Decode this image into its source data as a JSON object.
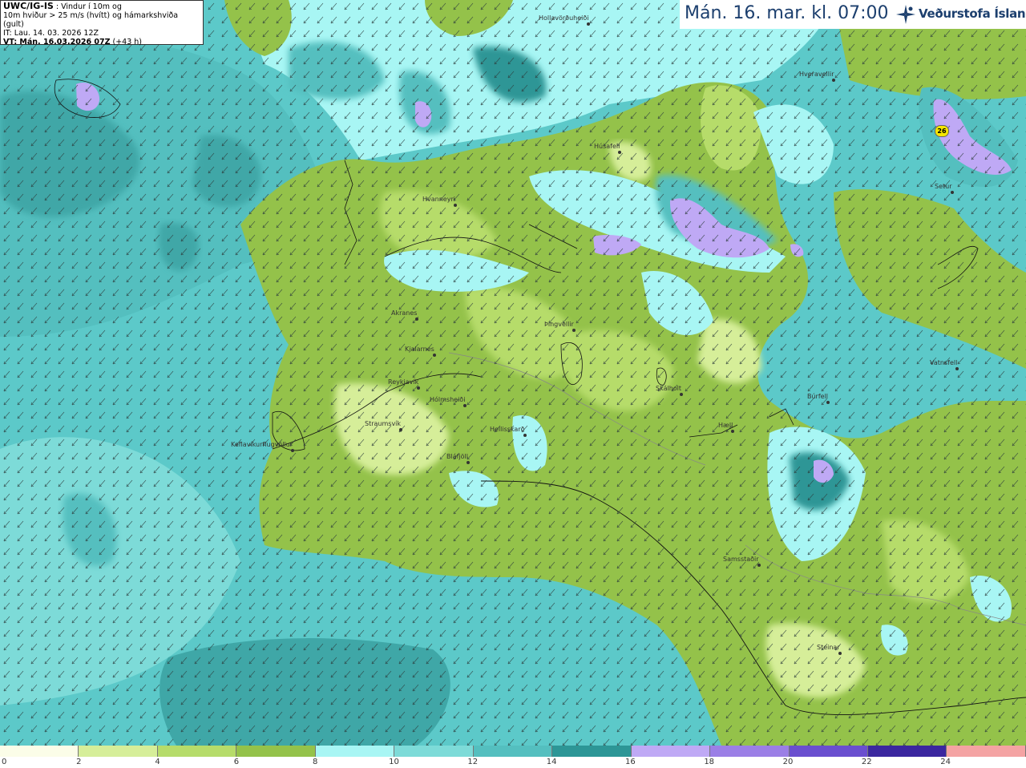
{
  "info": {
    "model": "UWC/IG-IS",
    "line1_suffix": " : Vindur í 10m og",
    "line2": "10m hviður > 25 m/s (hvítt) og hámarkshviða (gult)",
    "line3": "IT: Lau. 14. 03. 2026 12Z",
    "line4_bold": "VT: Mán. 16.03.2026 07Z",
    "line4_suffix": " (+43 h)"
  },
  "header": {
    "valid_time": "Mán. 16. mar. kl. 07:00",
    "brand": "Veðurstofa Íslands"
  },
  "colorbar": {
    "ticks": [
      "0",
      "2",
      "4",
      "6",
      "8",
      "10",
      "12",
      "14",
      "16",
      "18",
      "20",
      "22",
      "24"
    ],
    "colors": [
      "#fbfde8",
      "#d6ee99",
      "#b6dc6a",
      "#94c24a",
      "#a8f6f4",
      "#7ddbd8",
      "#54bfbf",
      "#2d9696",
      "#bfa9f5",
      "#9b7fe6",
      "#6a4fcf",
      "#3b279f",
      "#f4a3a3"
    ]
  },
  "max_gust": "26",
  "places": [
    {
      "name": "Hollavörðuheiði"
    },
    {
      "name": "Hveravellir"
    },
    {
      "name": "Húsafell"
    },
    {
      "name": "Hvanneyri"
    },
    {
      "name": "Setur"
    },
    {
      "name": "Akranes"
    },
    {
      "name": "Þingvellir"
    },
    {
      "name": "Kjalarnes"
    },
    {
      "name": "Reykjavík"
    },
    {
      "name": "Hólmsheiði"
    },
    {
      "name": "Straumsvík"
    },
    {
      "name": "Keflavíkurflugvöllur"
    },
    {
      "name": "Bláfjöll"
    },
    {
      "name": "Hellisskarð"
    },
    {
      "name": "Skálholt"
    },
    {
      "name": "Hæll"
    },
    {
      "name": "Búrfell"
    },
    {
      "name": "Vatnsfell"
    },
    {
      "name": "Samsstaðir"
    },
    {
      "name": "Steinar"
    }
  ]
}
